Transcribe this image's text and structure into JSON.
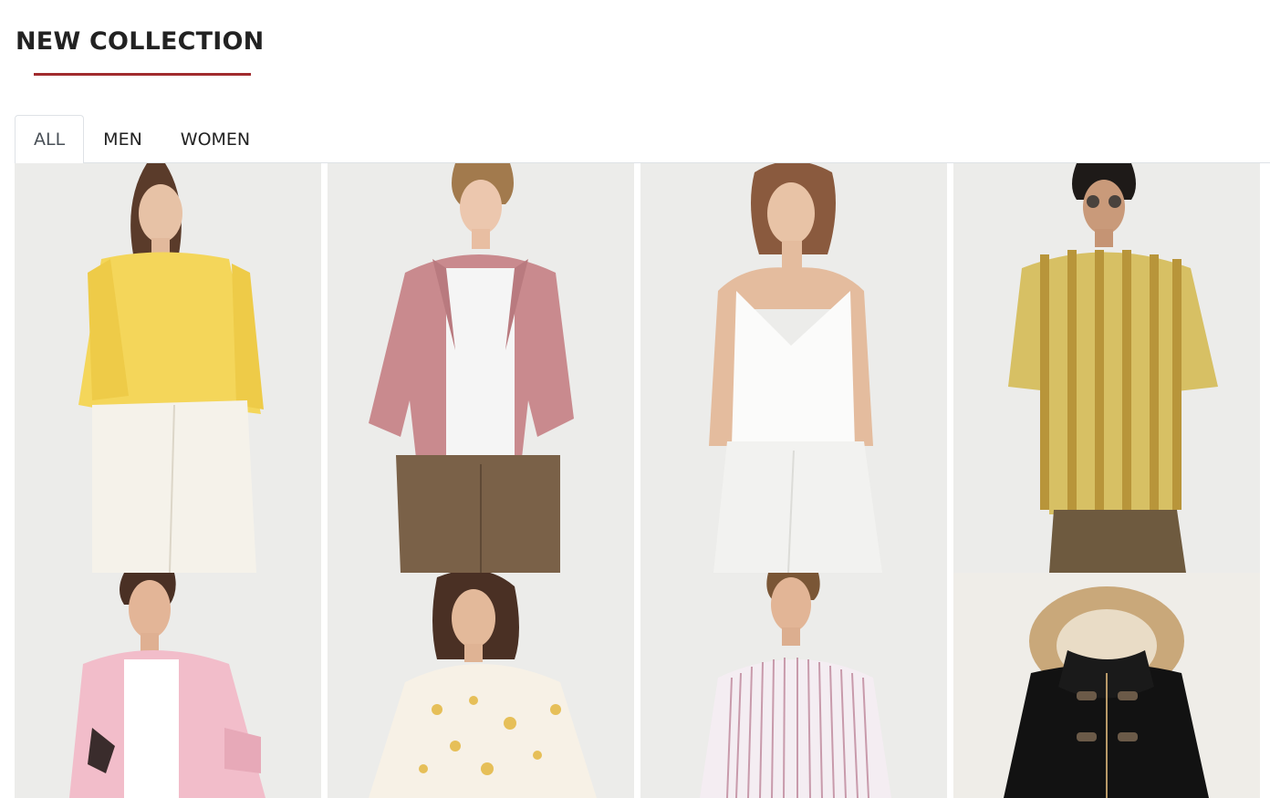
{
  "section": {
    "title": "NEW COLLECTION",
    "accent_color": "#a12b2e"
  },
  "tabs": [
    {
      "label": "ALL",
      "active": true
    },
    {
      "label": "MEN",
      "active": false
    },
    {
      "label": "WOMEN",
      "active": false
    }
  ],
  "products": [
    {
      "depicts": "woman in yellow blouse and white jeans",
      "icon": "product-photo"
    },
    {
      "depicts": "man in pink corduroy shirt over white tee",
      "icon": "product-photo"
    },
    {
      "depicts": "woman in white camisole and white jeans",
      "icon": "product-photo"
    },
    {
      "depicts": "man in yellow striped short-sleeve shirt",
      "icon": "product-photo"
    },
    {
      "depicts": "man in pink printed shirt",
      "icon": "product-photo"
    },
    {
      "depicts": "woman in floral print blouse",
      "icon": "product-photo"
    },
    {
      "depicts": "man in pink striped shirt",
      "icon": "product-photo"
    },
    {
      "depicts": "black duffle coat with fur hood",
      "icon": "product-photo"
    }
  ]
}
